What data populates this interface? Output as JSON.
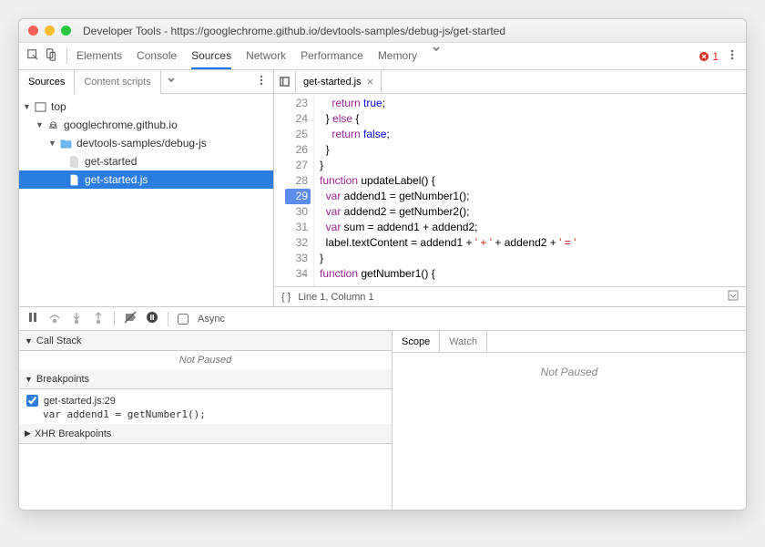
{
  "window": {
    "title": "Developer Tools - https://googlechrome.github.io/devtools-samples/debug-js/get-started"
  },
  "toolbar": {
    "tabs": [
      "Elements",
      "Console",
      "Sources",
      "Network",
      "Performance",
      "Memory"
    ],
    "active": 2,
    "errors": "1"
  },
  "navigator": {
    "tabs": [
      "Sources",
      "Content scripts"
    ],
    "tree": {
      "top": "top",
      "domain": "googlechrome.github.io",
      "folder": "devtools-samples/debug-js",
      "files": [
        "get-started",
        "get-started.js"
      ],
      "selected": "get-started.js"
    }
  },
  "editor": {
    "tab": "get-started.js",
    "lines": [
      {
        "n": 23,
        "html": "    <span class='kw'>return</span> <span class='lit'>true</span>;"
      },
      {
        "n": 24,
        "html": "  } <span class='kw'>else</span> {"
      },
      {
        "n": 25,
        "html": "    <span class='kw'>return</span> <span class='lit'>false</span>;"
      },
      {
        "n": 26,
        "html": "  }"
      },
      {
        "n": 27,
        "html": "}"
      },
      {
        "n": 28,
        "html": "<span class='kw'>function</span> updateLabel() {"
      },
      {
        "n": 29,
        "html": "  <span class='kw'>var</span> addend1 = getNumber1();",
        "bp": true
      },
      {
        "n": 30,
        "html": "  <span class='kw'>var</span> addend2 = getNumber2();"
      },
      {
        "n": 31,
        "html": "  <span class='kw'>var</span> sum = addend1 + addend2;"
      },
      {
        "n": 32,
        "html": "  label.textContent = addend1 + <span class='str'>' + '</span> + addend2 + <span class='str'>' = '</span>"
      },
      {
        "n": 33,
        "html": "}"
      },
      {
        "n": 34,
        "html": "<span class='kw'>function</span> getNumber1() {"
      }
    ],
    "status": "Line 1, Column 1"
  },
  "debugger": {
    "async_label": "Async",
    "sections": {
      "callstack": {
        "title": "Call Stack",
        "body": "Not Paused"
      },
      "breakpoints": {
        "title": "Breakpoints",
        "items": [
          {
            "label": "get-started.js:29",
            "code": "var addend1 = getNumber1();"
          }
        ]
      },
      "xhr": {
        "title": "XHR Breakpoints"
      }
    },
    "scope_watch": {
      "tabs": [
        "Scope",
        "Watch"
      ],
      "body": "Not Paused"
    }
  }
}
